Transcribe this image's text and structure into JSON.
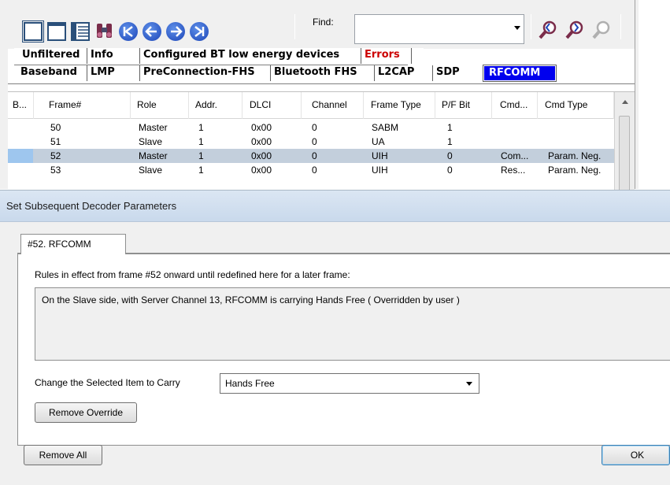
{
  "toolbar": {
    "find_label": "Find:",
    "find_value": "",
    "icons": [
      "single-pane-icon",
      "summary-pane-icon",
      "detail-pane-icon",
      "binoculars-icon",
      "first-frame-icon",
      "previous-frame-icon",
      "next-frame-icon",
      "last-frame-icon",
      "find-previous-icon",
      "find-next-icon",
      "find-clear-icon"
    ]
  },
  "tabs": {
    "row1": [
      "Unfiltered",
      "Info",
      "Configured BT low energy devices",
      "Errors"
    ],
    "row2": [
      "Baseband",
      "LMP",
      "PreConnection-FHS",
      "Bluetooth FHS",
      "L2CAP",
      "SDP",
      "RFCOMM"
    ],
    "active": "RFCOMM",
    "error_color": "#cc0000",
    "active_color": "#0000ee"
  },
  "grid": {
    "columns": [
      "B...",
      "Frame#",
      "Role",
      "Addr.",
      "DLCI",
      "Channel",
      "Frame Type",
      "P/F Bit",
      "Cmd...",
      "Cmd Type"
    ],
    "rows": [
      {
        "frame": "50",
        "role": "Master",
        "addr": "1",
        "dlci": "0x00",
        "channel": "0",
        "type": "SABM",
        "pf": "1",
        "cmd": "",
        "cmdtype": ""
      },
      {
        "frame": "51",
        "role": "Slave",
        "addr": "1",
        "dlci": "0x00",
        "channel": "0",
        "type": "UA",
        "pf": "1",
        "cmd": "",
        "cmdtype": ""
      },
      {
        "frame": "52",
        "role": "Master",
        "addr": "1",
        "dlci": "0x00",
        "channel": "0",
        "type": "UIH",
        "pf": "0",
        "cmd": "Com...",
        "cmdtype": "Param. Neg."
      },
      {
        "frame": "53",
        "role": "Slave",
        "addr": "1",
        "dlci": "0x00",
        "channel": "0",
        "type": "UIH",
        "pf": "0",
        "cmd": "Res...",
        "cmdtype": "Param. Neg."
      }
    ],
    "selected_frame": "52"
  },
  "dialog": {
    "title": "Set Subsequent Decoder Parameters",
    "tab_label": "#52. RFCOMM",
    "rules_label": "Rules in effect from frame #52 onward until redefined here for a later frame:",
    "rules": [
      "On the Slave side, with Server Channel 13, RFCOMM is carrying Hands Free ( Overridden by user )"
    ],
    "carry_label": "Change the Selected Item to Carry",
    "carry_value": "Hands Free",
    "remove_override": "Remove Override",
    "remove_all": "Remove All",
    "ok": "OK"
  }
}
